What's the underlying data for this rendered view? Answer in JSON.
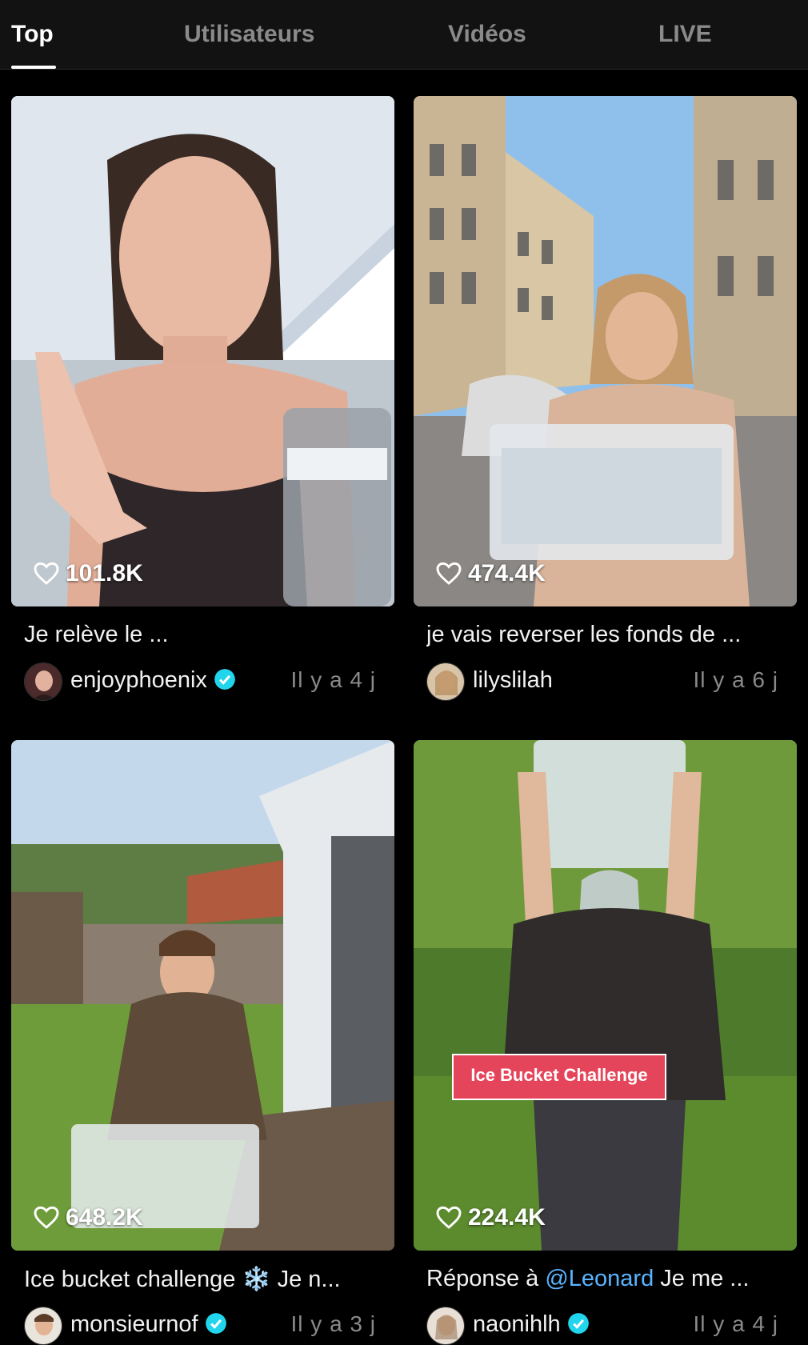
{
  "tabs": [
    {
      "label": "Top",
      "active": true
    },
    {
      "label": "Utilisateurs",
      "active": false
    },
    {
      "label": "Vidéos",
      "active": false
    },
    {
      "label": "LIVE",
      "active": false
    }
  ],
  "videos": [
    {
      "likes": "101.8K",
      "caption": "Je relève le ...",
      "username": "enjoyphoenix",
      "verified": true,
      "time": "Il y a 4 j"
    },
    {
      "likes": "474.4K",
      "caption": "je vais reverser les fonds de ...",
      "username": "lilyslilah",
      "verified": false,
      "time": "Il y a 6 j"
    },
    {
      "likes": "648.2K",
      "caption": "Ice bucket challenge ❄️ Je n...",
      "username": "monsieurnof",
      "verified": true,
      "time": "Il y a 3 j"
    },
    {
      "likes": "224.4K",
      "caption_prefix": "Réponse à ",
      "caption_mention": "@Leonard",
      "caption_suffix": " Je me ...",
      "username": "naonihlh",
      "verified": true,
      "time": "Il y a 4 j",
      "sticker": "Ice Bucket Challenge"
    }
  ],
  "colors": {
    "background": "#000000",
    "tab_active": "#ffffff",
    "tab_inactive": "#8a8a8a",
    "verified": "#20d5ec",
    "mention": "#5ab4ff",
    "sticker": "#e5455a"
  },
  "icons": {
    "like": "heart-outline-icon",
    "verified": "verified-badge-icon"
  }
}
